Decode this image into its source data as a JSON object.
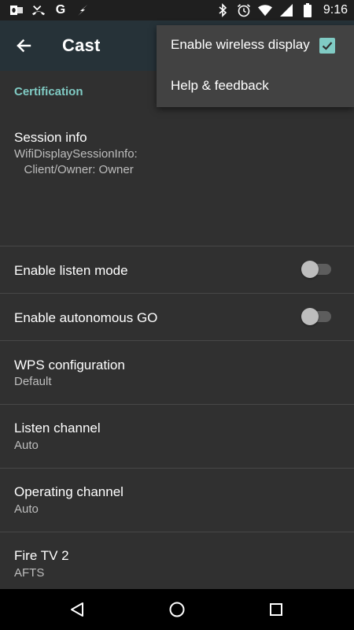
{
  "status_bar": {
    "left_icons": [
      "outlook-icon",
      "missed-call-icon",
      "google-icon",
      "flash-icon"
    ],
    "g_label": "G",
    "right_icons": [
      "bluetooth-icon",
      "alarm-icon",
      "wifi-icon",
      "cell-signal-icon",
      "battery-icon"
    ],
    "time": "9:16"
  },
  "app_bar": {
    "title": "Cast",
    "back_icon": "arrow-back-icon",
    "color": "#263238"
  },
  "overflow_menu": {
    "items": [
      {
        "label": "Enable wireless display",
        "checked": true
      },
      {
        "label": "Help & feedback"
      }
    ]
  },
  "settings": {
    "category": "Certification",
    "session_info": {
      "title": "Session info",
      "summary": "WifiDisplaySessionInfo:\n   Client/Owner: Owner"
    },
    "listen_mode": {
      "title": "Enable listen mode",
      "enabled": false
    },
    "autonomous_go": {
      "title": "Enable autonomous GO",
      "enabled": false
    },
    "wps_configuration": {
      "title": "WPS configuration",
      "summary": "Default"
    },
    "listen_channel": {
      "title": "Listen channel",
      "summary": "Auto"
    },
    "operating_channel": {
      "title": "Operating channel",
      "summary": "Auto"
    },
    "device": {
      "title": "Fire TV 2",
      "summary": "AFTS"
    }
  },
  "nav_bar": {
    "buttons": [
      "back-triangle-icon",
      "home-circle-icon",
      "recents-square-icon"
    ]
  },
  "colors": {
    "accent": "#80cbc4",
    "background": "#303030",
    "menu_background": "#424242",
    "status_bar": "#1f1f1f"
  }
}
